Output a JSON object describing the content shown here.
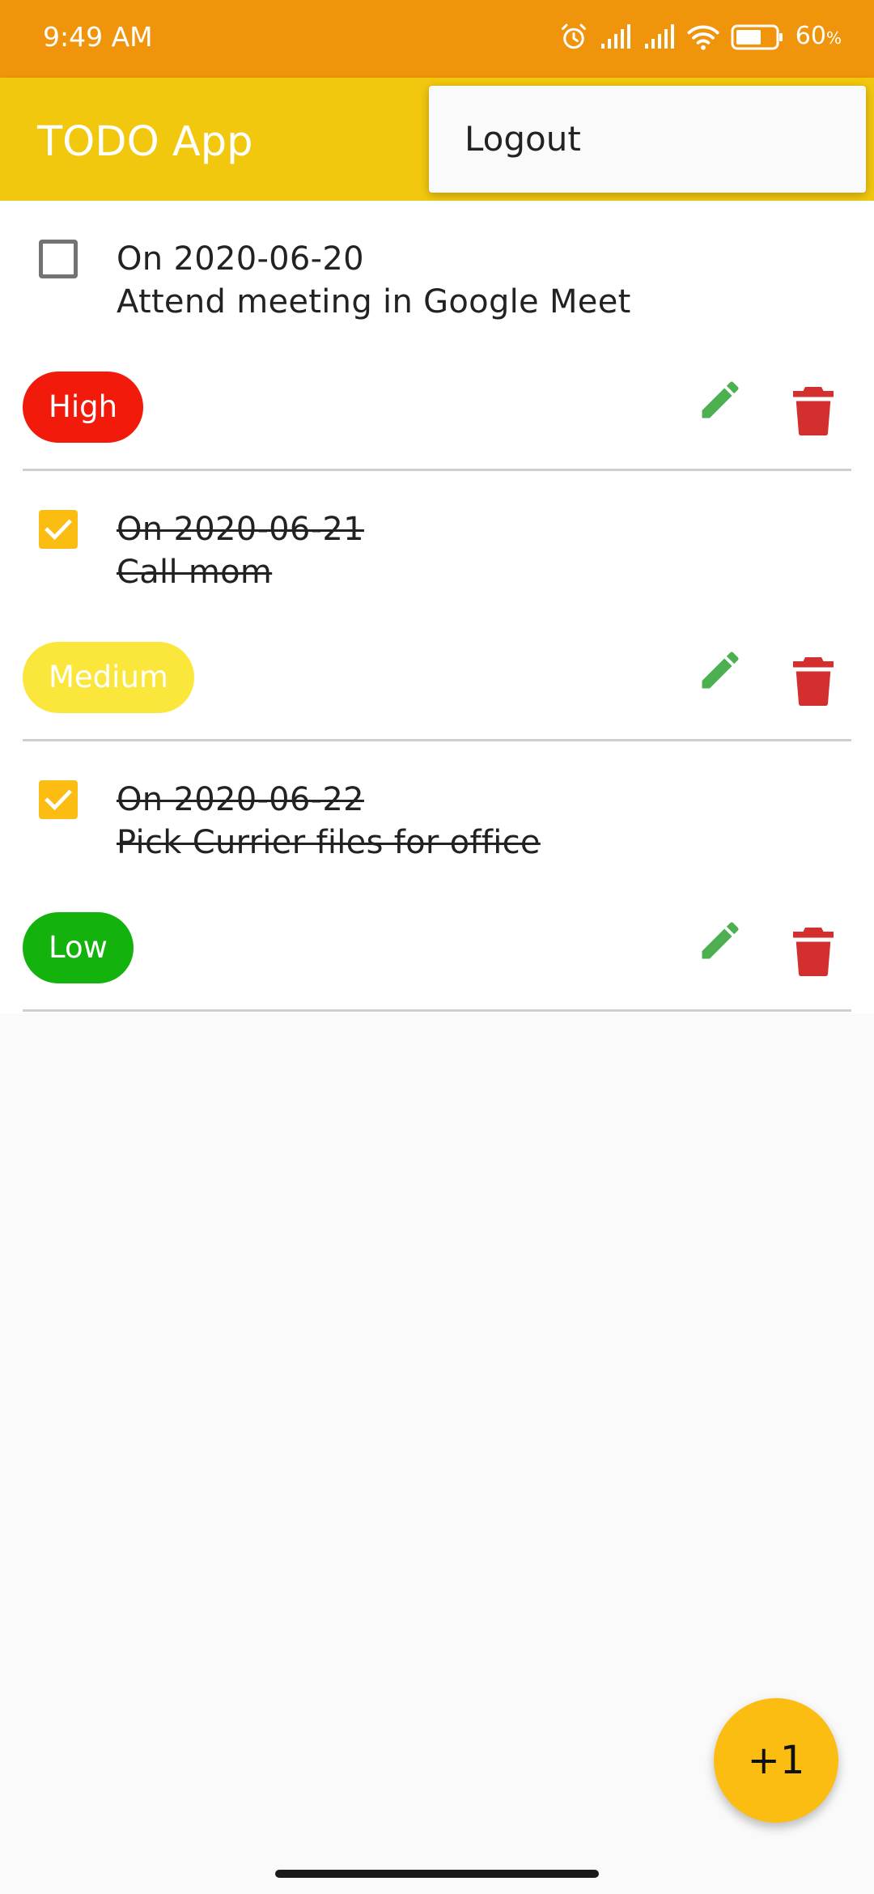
{
  "status_bar": {
    "time": "9:49 AM",
    "battery_percent": "60",
    "battery_unit": "%",
    "icons": [
      "alarm-icon",
      "signal-icon",
      "signal-icon",
      "wifi-icon",
      "battery-icon"
    ]
  },
  "app_bar": {
    "title": "TODO App"
  },
  "menu": {
    "logout_label": "Logout"
  },
  "todos": [
    {
      "date_line": "On 2020-06-20",
      "title": "Attend meeting in Google Meet",
      "done": false,
      "priority": "High",
      "priority_color": "#f21a0a"
    },
    {
      "date_line": "On 2020-06-21",
      "title": "Call mom",
      "done": true,
      "priority": "Medium",
      "priority_color": "#fbe73b"
    },
    {
      "date_line": "On 2020-06-22",
      "title": "Pick Currier files for office",
      "done": true,
      "priority": "Low",
      "priority_color": "#14b20d"
    }
  ],
  "fab": {
    "label": "+1"
  },
  "colors": {
    "status_bar": "#f0940c",
    "app_bar": "#f2c80f",
    "accent": "#fcbd12",
    "edit_icon": "#4caf50",
    "delete_icon": "#d32f2f"
  }
}
